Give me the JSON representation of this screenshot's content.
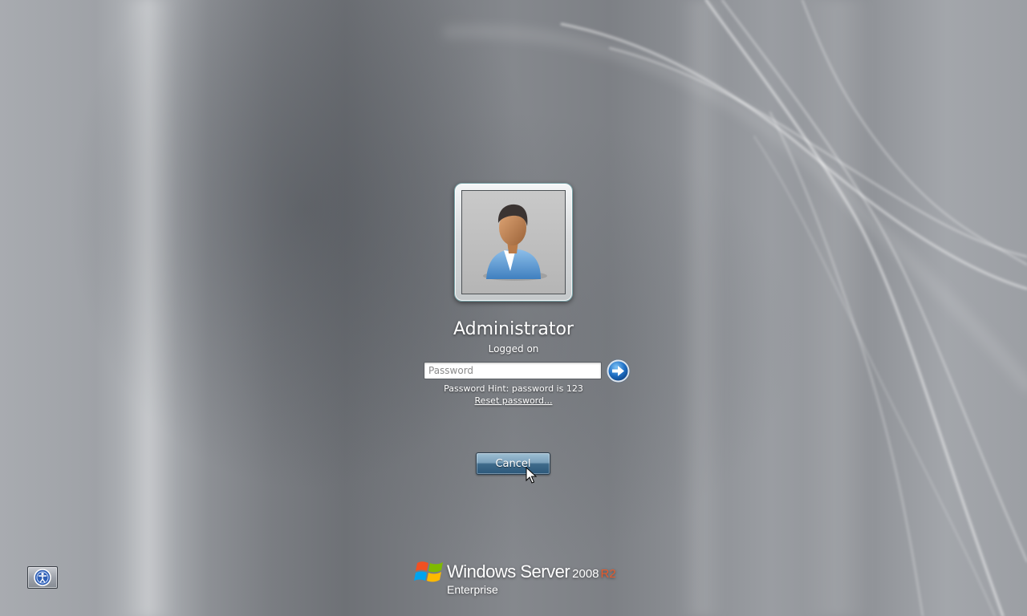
{
  "user": {
    "name": "Administrator",
    "status": "Logged on"
  },
  "password": {
    "placeholder": "Password",
    "value": "",
    "submit_icon": "arrow-right-icon",
    "hint": "Password Hint: password is 123",
    "reset_link": "Reset password..."
  },
  "actions": {
    "cancel_label": "Cancel"
  },
  "accessibility": {
    "icon": "ease-of-access-icon"
  },
  "branding": {
    "product": "Windows Server",
    "version": "2008",
    "release": "R2",
    "edition": "Enterprise",
    "release_color": "#e85a2a"
  },
  "colors": {
    "background": "#8a8d92",
    "button_accent": "#3e6a8a",
    "text": "#ffffff"
  }
}
